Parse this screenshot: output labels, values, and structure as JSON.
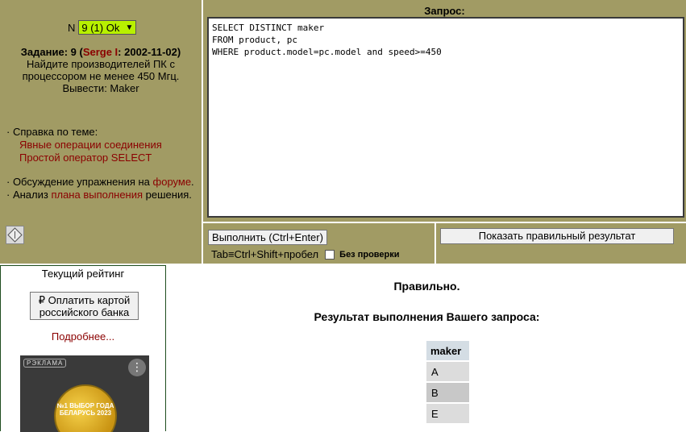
{
  "task": {
    "number_label": "N",
    "select_value": "9 (1) Ok",
    "title_prefix": "Задание: 9 (",
    "author": "Serge I",
    "title_suffix": ": 2002-11-02)",
    "description": "Найдите производителей ПК с процессором не менее 450 Мгц. Вывести: Maker"
  },
  "help": {
    "heading": "· Справка по теме:",
    "links": [
      "Явные операции соединения",
      "Простой оператор SELECT"
    ]
  },
  "discussion": {
    "text1": "· Обсуждение упражнения на ",
    "forum_link": "форуме",
    "text1_end": ".",
    "text2": "· Анализ ",
    "plan_link": "плана выполнения",
    "text2_end": " решения."
  },
  "query": {
    "label": "Запрос:",
    "sql": "SELECT DISTINCT maker\nFROM product, pc\nWHERE product.model=pc.model and speed>=450",
    "execute_button": "Выполнить (Ctrl+Enter)",
    "tab_hint": "Tab≡Ctrl+Shift+пробел",
    "no_check_label": "Без проверки",
    "show_correct_button": "Показать правильный результат"
  },
  "rating": {
    "title": "Текущий рейтинг",
    "pay_button": "₽ Оплатить картой российского банка",
    "more_link": "Подробнее...",
    "ad_label": "РЭКЛАМА",
    "ad_menu": "⋮",
    "medal_text": "№1 ВЫБОР ГОДА БЕЛАРУСЬ 2023"
  },
  "result": {
    "status": "Правильно.",
    "title": "Результат выполнения Вашего запроса:",
    "columns": [
      "maker"
    ],
    "rows": [
      "A",
      "B",
      "E"
    ]
  },
  "colors": {
    "panel_olive": "#a19b64",
    "link_dark_red": "#8b0000",
    "select_green": "#b8f000"
  }
}
